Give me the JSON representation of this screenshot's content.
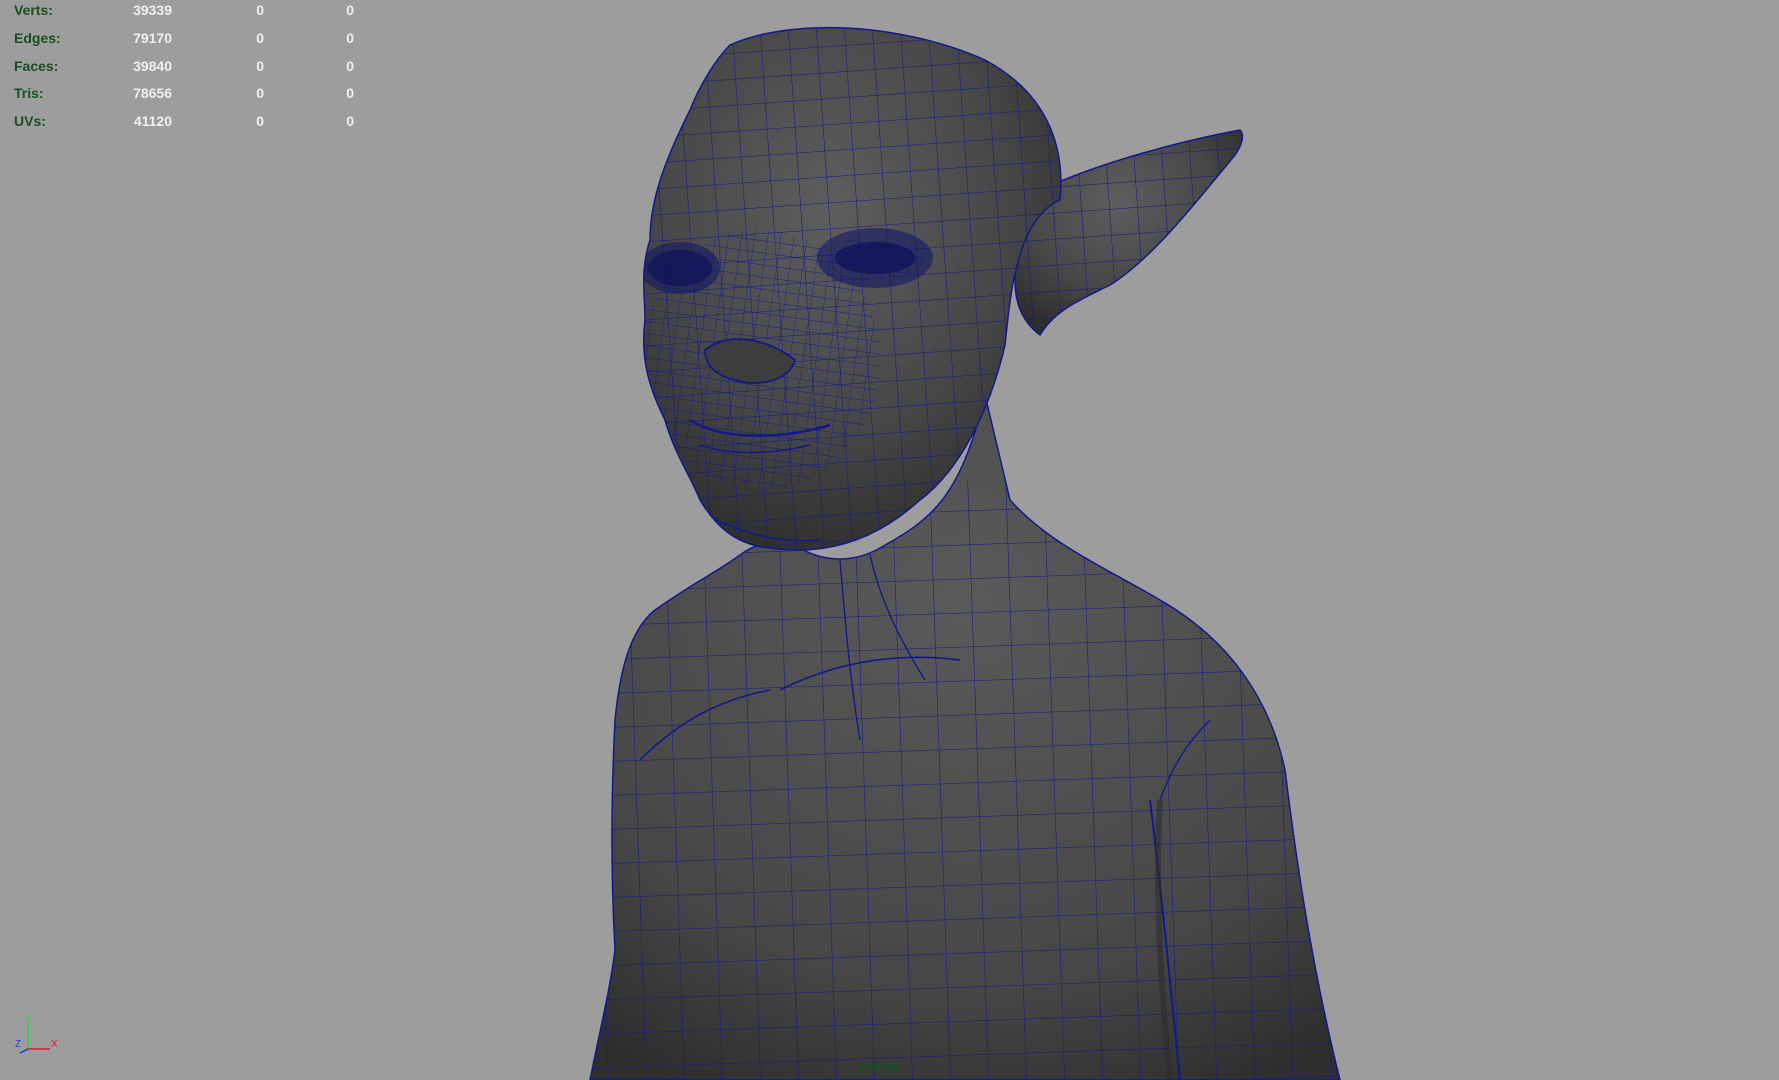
{
  "viewport": {
    "camera": "persp",
    "background_color": "#9d9d9d",
    "mesh_color": "#4d4d4d",
    "wire_color": "#101a8c",
    "hud_label_color": "#1a4f22",
    "object_icon": "goblin-character-mesh"
  },
  "hud": {
    "rows": [
      {
        "label": "Verts:",
        "total": "39339",
        "selected": "0",
        "component": "0"
      },
      {
        "label": "Edges:",
        "total": "79170",
        "selected": "0",
        "component": "0"
      },
      {
        "label": "Faces:",
        "total": "39840",
        "selected": "0",
        "component": "0"
      },
      {
        "label": "Tris:",
        "total": "78656",
        "selected": "0",
        "component": "0"
      },
      {
        "label": "UVs:",
        "total": "41120",
        "selected": "0",
        "component": "0"
      }
    ]
  },
  "axis": {
    "y": "Y",
    "z": "Z",
    "x": "X"
  }
}
